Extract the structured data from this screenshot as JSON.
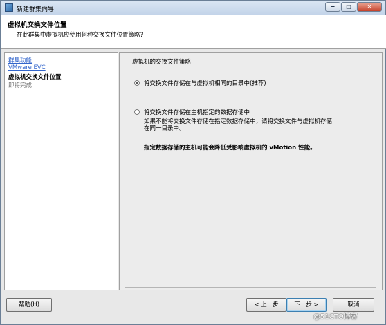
{
  "window": {
    "title": "新建群集向导",
    "close_glyph": "✕"
  },
  "header": {
    "title": "虚拟机交换文件位置",
    "subtitle": "在此群集中虚拟机应使用何种交换文件位置策略?"
  },
  "nav": {
    "items": [
      {
        "label": "群集功能",
        "state": "link"
      },
      {
        "label": "VMware EVC",
        "state": "link"
      },
      {
        "label": "虚拟机交换文件位置",
        "state": "current"
      },
      {
        "label": "即将完成",
        "state": "pending"
      }
    ]
  },
  "content": {
    "group_label": "虚拟机的交换文件策略",
    "options": [
      {
        "label": "将交换文件存储在与虚拟机相同的目录中(推荐)",
        "selected": true
      },
      {
        "label": "将交换文件存储在主机指定的数据存储中",
        "selected": false
      }
    ],
    "description_line1": "如果不能将交换文件存储在指定数据存储中，请将交换文件与虚拟机存储",
    "description_line2": "在同一目录中。",
    "warning": "指定数据存储的主机可能会降低受影响虚拟机的 vMotion 性能。"
  },
  "buttons": {
    "help": "帮助(H)",
    "back": "< 上一步",
    "next": "下一步 >",
    "cancel": "取消"
  },
  "watermark": "@51CTO博客"
}
